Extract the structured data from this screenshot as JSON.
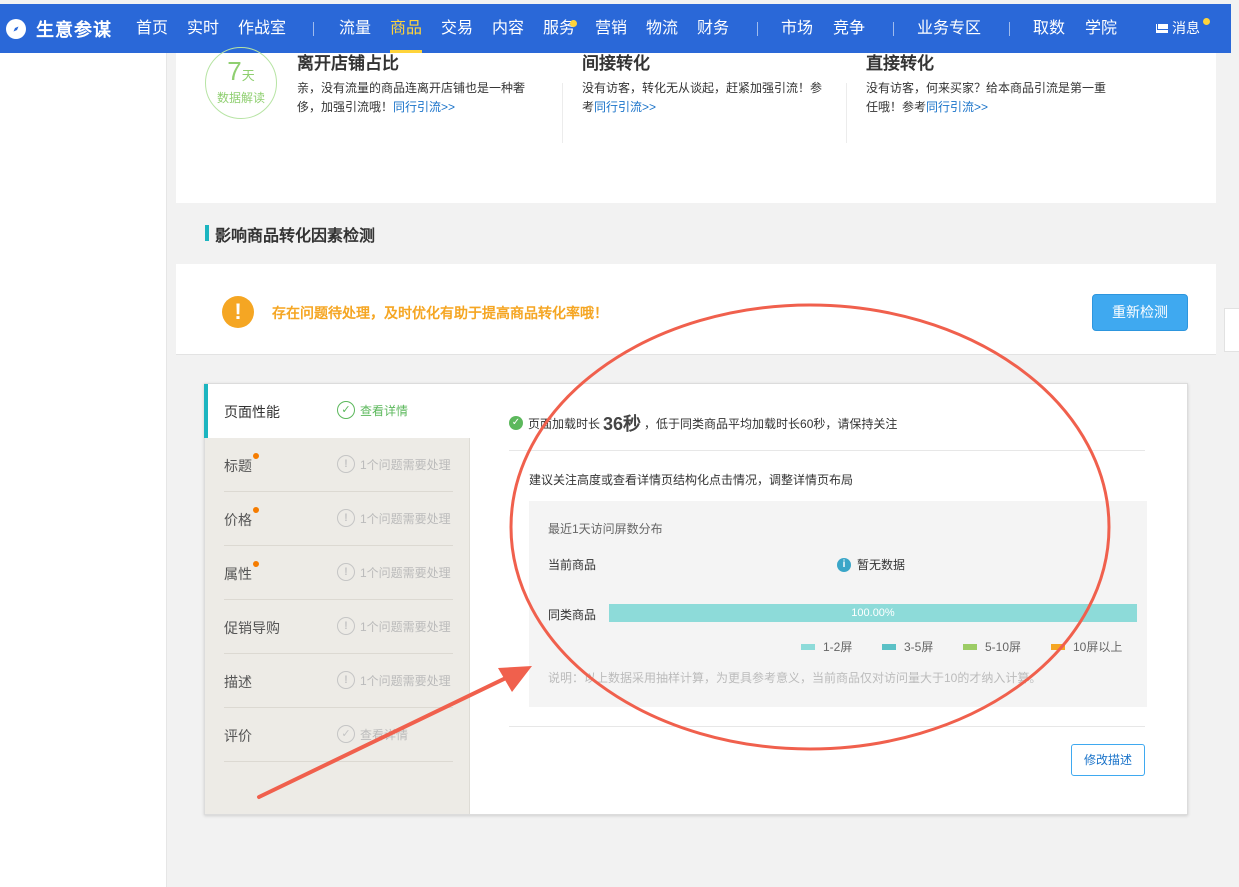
{
  "nav": {
    "brand": "生意参谋",
    "items": [
      {
        "label": "首页",
        "active": false
      },
      {
        "label": "实时",
        "active": false
      },
      {
        "label": "作战室",
        "active": false
      },
      {
        "label": "流量",
        "active": false
      },
      {
        "label": "商品",
        "active": true
      },
      {
        "label": "交易",
        "active": false
      },
      {
        "label": "内容",
        "active": false
      },
      {
        "label": "服务",
        "active": false,
        "dot": true
      },
      {
        "label": "营销",
        "active": false
      },
      {
        "label": "物流",
        "active": false
      },
      {
        "label": "财务",
        "active": false
      },
      {
        "label": "市场",
        "active": false
      },
      {
        "label": "竞争",
        "active": false
      },
      {
        "label": "业务专区",
        "active": false
      },
      {
        "label": "取数",
        "active": false
      },
      {
        "label": "学院",
        "active": false
      }
    ],
    "message": "消息",
    "accent": "#ffd43b",
    "bg": "#2a68d8"
  },
  "summary": {
    "badge": {
      "num": "7",
      "unit": "天",
      "label": "数据解读"
    },
    "cols": [
      {
        "title": "离开店铺占比",
        "text": "亲，没有流量的商品连离开店铺也是一种奢侈，加强引流哦！",
        "link": "同行引流>>"
      },
      {
        "title": "间接转化",
        "text": "没有访客，转化无从谈起，赶紧加强引流！参考",
        "link": "同行引流>>"
      },
      {
        "title": "直接转化",
        "text": "没有访客，何来买家？给本商品引流是第一重任哦！参考",
        "link": "同行引流>>"
      }
    ]
  },
  "section": {
    "title": "影响商品转化因素检测"
  },
  "alert": {
    "text": "存在问题待处理，及时优化有助于提高商品转化率哦！",
    "button": "重新检测"
  },
  "tabs": [
    {
      "label": "页面性能",
      "status": "查看详情",
      "active": true,
      "warn": false,
      "ok": true
    },
    {
      "label": "标题",
      "status": "1个问题需要处理",
      "active": false,
      "warn": true,
      "ok": false
    },
    {
      "label": "价格",
      "status": "1个问题需要处理",
      "active": false,
      "warn": true,
      "ok": false
    },
    {
      "label": "属性",
      "status": "1个问题需要处理",
      "active": false,
      "warn": true,
      "ok": false
    },
    {
      "label": "促销导购",
      "status": "1个问题需要处理",
      "active": false,
      "warn": false,
      "ok": false
    },
    {
      "label": "描述",
      "status": "1个问题需要处理",
      "active": false,
      "warn": false,
      "ok": false
    },
    {
      "label": "评价",
      "status": "查看详情",
      "active": false,
      "warn": false,
      "ok": true
    }
  ],
  "performance": {
    "prefix": "页面加载时长",
    "time": "36秒",
    "suffix": "，低于同类商品平均加载时长60秒，请保持关注",
    "suggestion": "建议关注高度或查看详情页结构化点击情况，调整详情页布局",
    "dist_title": "最近1天访问屏数分布",
    "current_label": "当前商品",
    "no_data": "暂无数据",
    "peer_label": "同类商品",
    "peer_bar": {
      "value": 1.0,
      "text": "100.00%",
      "color": "#8ddbd9"
    },
    "legend": [
      {
        "label": "1-2屏",
        "color": "#8ddbd9"
      },
      {
        "label": "3-5屏",
        "color": "#5bc1c6"
      },
      {
        "label": "5-10屏",
        "color": "#9ccc65"
      },
      {
        "label": "10屏以上",
        "color": "#f5a623"
      }
    ],
    "note": "说明：以上数据采用抽样计算，为更具参考意义，当前商品仅对访问量大于10的才纳入计算。",
    "edit_button": "修改描述"
  },
  "annotation": {
    "color": "#f0604d"
  }
}
